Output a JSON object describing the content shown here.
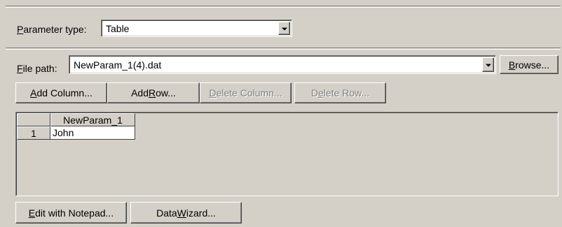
{
  "parameter_type": {
    "label_prefix": "",
    "label_accel": "P",
    "label_rest": "arameter type:",
    "selected_value": "Table"
  },
  "file_path": {
    "label_accel": "F",
    "label_rest": "ile path:",
    "value": "NewParam_1(4).dat",
    "browse_accel": "B",
    "browse_rest": "rowse..."
  },
  "toolbar": {
    "add_column": {
      "accel": "A",
      "rest": "dd Column...",
      "enabled": true
    },
    "add_row": {
      "pre": "Add ",
      "accel": "R",
      "rest": "ow...",
      "enabled": true
    },
    "delete_column": {
      "accel": "D",
      "rest": "elete Column...",
      "enabled": false
    },
    "delete_row": {
      "pre": "D",
      "accel": "e",
      "rest": "lete Row...",
      "enabled": false
    }
  },
  "table": {
    "columns": [
      "NewParam_1"
    ],
    "rows": [
      {
        "index": "1",
        "cells": [
          "John"
        ]
      }
    ]
  },
  "bottom": {
    "edit_notepad": {
      "accel": "E",
      "rest": "dit with Notepad..."
    },
    "data_wizard": {
      "pre": "Data ",
      "accel": "W",
      "rest": "izard..."
    }
  }
}
